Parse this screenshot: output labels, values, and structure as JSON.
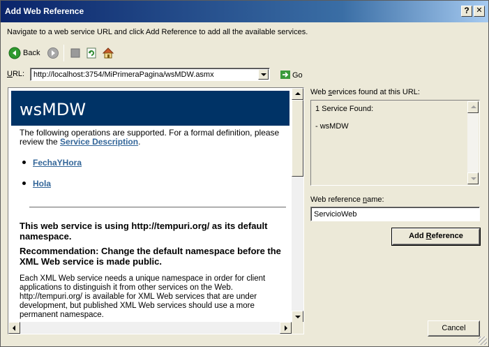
{
  "window": {
    "title": "Add Web Reference",
    "help_button": "?",
    "close_button": "✕"
  },
  "instruction": "Navigate to a web service URL and click Add Reference to add all the available services.",
  "toolbar": {
    "back_label": "Back",
    "icons": [
      "back-icon",
      "forward-icon",
      "stop-icon",
      "refresh-icon",
      "home-icon"
    ]
  },
  "url_bar": {
    "label_prefix": "",
    "label_underlined": "U",
    "label_rest": "RL:",
    "value": "http://localhost:3754/MiPrimeraPagina/wsMDW.asmx",
    "go_label": "Go"
  },
  "browser_page": {
    "heading": "wsMDW",
    "intro_text": "The following operations are supported. For a formal definition, please review the ",
    "intro_link": "Service Description",
    "intro_end": ".",
    "operations": [
      "FechaYHora",
      "Hola"
    ],
    "warning_title": "This web service is using http://tempuri.org/ as its default namespace.",
    "recommendation": "Recommendation: Change the default namespace before the XML Web service is made public.",
    "paragraph": "Each XML Web service needs a unique namespace in order for client applications to distinguish it from other services on the Web. http://tempuri.org/ is available for XML Web services that are under development, but published XML Web services should use a more permanent namespace."
  },
  "services_panel": {
    "label_pre": "Web ",
    "label_underlined": "s",
    "label_post": "ervices found at this URL:",
    "found_text": "1 Service Found:",
    "service_item": "- wsMDW"
  },
  "reference": {
    "label_pre": "Web reference ",
    "label_underlined": "n",
    "label_post": "ame:",
    "value": "ServicioWeb"
  },
  "buttons": {
    "add_pre": "Add ",
    "add_underlined": "R",
    "add_post": "eference",
    "cancel": "Cancel"
  }
}
